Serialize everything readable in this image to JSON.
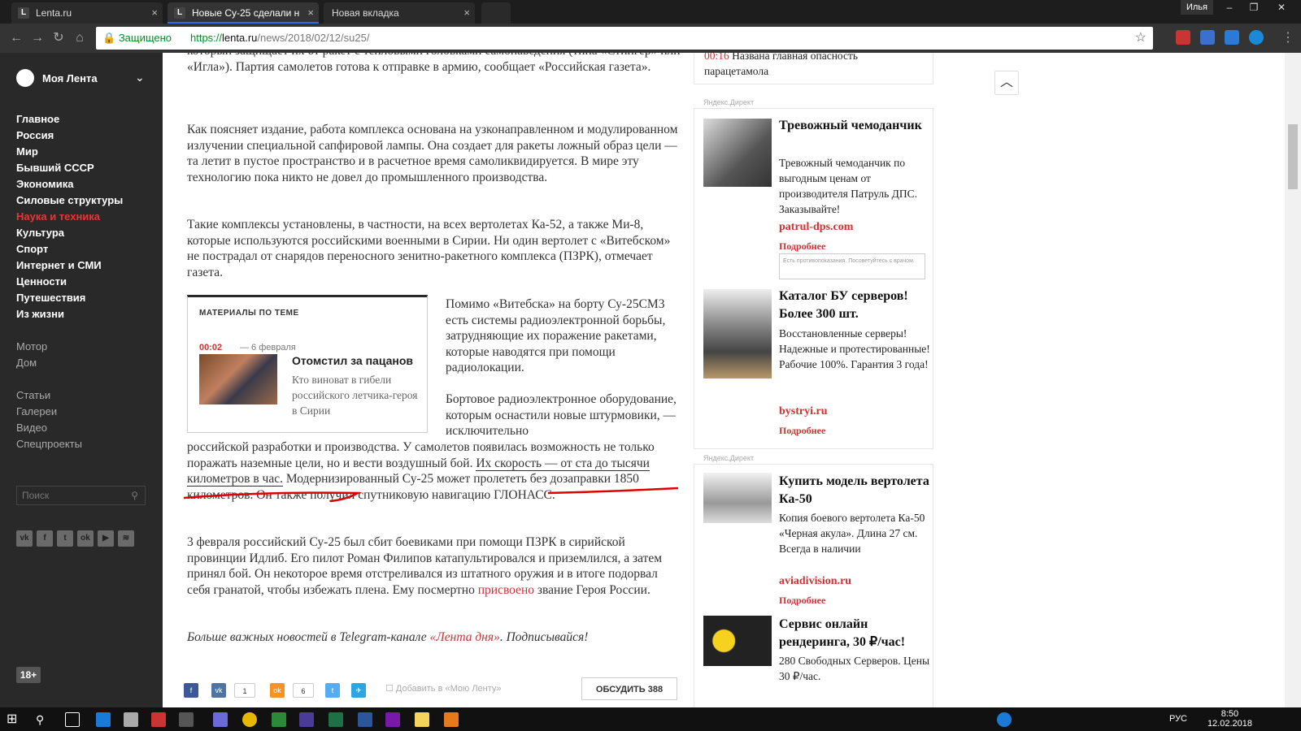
{
  "browser": {
    "tabs": [
      {
        "favicon": "L",
        "title": "Lenta.ru"
      },
      {
        "favicon": "L",
        "title": "Новые Су-25 сделали н"
      },
      {
        "favicon": "",
        "title": "Новая вкладка"
      }
    ],
    "user_name": "Илья",
    "secure_label": "Защищено",
    "url_scheme": "https://",
    "url_host": "lenta.ru",
    "url_path": "/news/2018/02/12/su25/"
  },
  "sidebar": {
    "my_lenta": "Моя Лента",
    "main_items": [
      "Главное",
      "Россия",
      "Мир",
      "Бывший СССР",
      "Экономика",
      "Силовые структуры",
      "Наука и техника",
      "Культура",
      "Спорт",
      "Интернет и СМИ",
      "Ценности",
      "Путешествия",
      "Из жизни"
    ],
    "active_item": "Наука и техника",
    "secondary_items": [
      "Мотор",
      "Дом"
    ],
    "tertiary_items": [
      "Статьи",
      "Галереи",
      "Видео",
      "Спецпроекты"
    ],
    "search_placeholder": "Поиск",
    "social": [
      "vk",
      "f",
      "t",
      "ok",
      "yt",
      "rss"
    ],
    "age_badge": "18+"
  },
  "article": {
    "p0": "который защищает их от ракет с тепловыми головками самонаведения (типа «Стингер» или «Игла»). Партия самолетов готова к отправке в армию, сообщает «Российская газета».",
    "p1": "Как поясняет издание, работа комплекса основана на узконаправленном и модулированном излучении специальной сапфировой лампы. Она создает для ракеты ложный образ цели — та летит в пустое пространство и в расчетное время самоликвидируется. В мире эту технологию пока никто не довел до промышленного производства.",
    "p2": "Такие комплексы установлены, в частности, на всех вертолетах Ка-52, а также Ми-8, которые используются российскими военными в Сирии. Ни один вертолет с «Витебском» не пострадал от снарядов переносного зенитно-ракетного комплекса (ПЗРК), отмечает газета.",
    "p3": "Помимо «Витебска» на борту Су-25СМ3 есть системы радиоэлектронной борьбы, затрудняющие их поражение ракетами, которые наводятся при помощи радиолокации.",
    "p4_narrow": "Бортовое радиоэлектронное оборудование, которым оснастили новые штурмовики, — исключительно",
    "p4_wide": "российской разработки и производства. У самолетов появилась возможность не только поражать наземные цели, но и вести воздушный бой.",
    "p4_highlight": "Их скорость — от ста до тысячи километров в час.",
    "p4_tail": "Модернизированный Су-25 может пролететь без дозаправки 1850 километров. Он также получил спутниковую навигацию ГЛОНАСС.",
    "p5": "3 февраля российский Су-25 был сбит боевиками при помощи ПЗРК в сирийской провинции Идлиб. Его пилот Роман Филипов катапультировался и приземлился, а затем принял бой. Он некоторое время отстреливался из штатного оружия и в итоге подорвал себя гранатой, чтобы избежать плена. Ему посмертно",
    "p5_link": "присвоено",
    "p5_tail": "звание Героя России.",
    "footer_pre": "Больше важных новостей в Telegram-канале",
    "footer_link": "«Лента дня»",
    "footer_post": ". Подписывайся!"
  },
  "related": {
    "heading": "МАТЕРИАЛЫ ПО ТЕМЕ",
    "time": "00:02",
    "date": "— 6 февраля",
    "title": "Отомстил за пацанов",
    "desc": "Кто виноват в гибели российского летчика-героя в Сирии"
  },
  "share": {
    "counts": [
      "1",
      "6"
    ],
    "favorite_label": "Добавить в «Мою Ленту»",
    "discuss_label": "ОБСУДИТЬ 388"
  },
  "right": {
    "top_news_time": "00:16",
    "top_news_text": "Названа главная опасность парацетамола",
    "ads": [
      {
        "label": "Яндекс.Директ",
        "title": "Тревожный чемоданчик",
        "text": "Тревожный чемоданчик по выгодным ценам от производителя Патруль ДПС. Заказывайте!",
        "domain": "patrul-dps.com",
        "more": "Подробнее",
        "feedback": "Есть противопоказания. Посоветуйтесь с врачом."
      },
      {
        "label": "",
        "title": "Каталог БУ серверов! Более 300 шт.",
        "text": "Восстановленные серверы! Надежные и протестированные! Рабочие 100%. Гарантия 3 года!",
        "domain": "bystryi.ru",
        "more": "Подробнее"
      },
      {
        "label": "Яндекс.Директ",
        "title": "Купить модель вертолета Ка-50",
        "text": "Копия боевого вертолета Ка-50 «Черная акула». Длина 27 см. Всегда в наличии",
        "domain": "aviadivision.ru",
        "more": "Подробнее"
      },
      {
        "label": "",
        "title": "Сервис онлайн рендеринга, 30 ₽/час!",
        "text": "280 Свободных Серверов. Цены 30 ₽/час.",
        "domain": "",
        "more": ""
      }
    ]
  },
  "taskbar": {
    "lang": "РУС",
    "time": "8:50",
    "date": "12.02.2018"
  }
}
